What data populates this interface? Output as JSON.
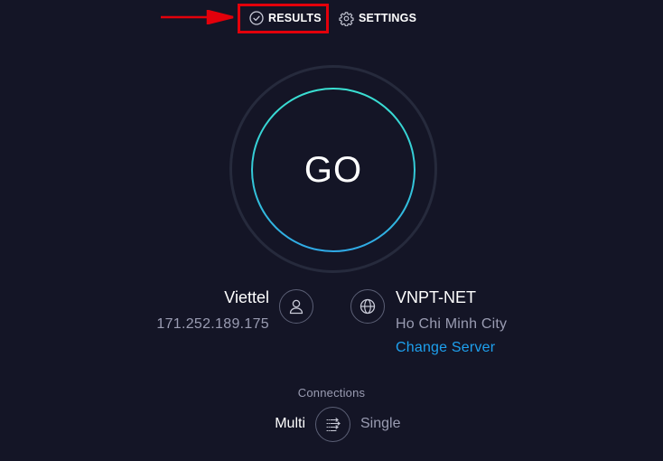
{
  "nav": {
    "results_label": "RESULTS",
    "settings_label": "SETTINGS",
    "results_icon": "check-circle-icon",
    "settings_icon": "gear-icon",
    "highlight_color": "#e3000b"
  },
  "go_button": {
    "label": "GO",
    "ring_colors": [
      "#3ae0d2",
      "#2fa9e6"
    ]
  },
  "provider": {
    "name": "Viettel",
    "ip": "171.252.189.175",
    "icon": "user-icon"
  },
  "server": {
    "name": "VNPT-NET",
    "location": "Ho Chi Minh City",
    "change_label": "Change Server",
    "icon": "globe-icon",
    "link_color": "#1ea0ee"
  },
  "connections": {
    "title": "Connections",
    "multi_label": "Multi",
    "single_label": "Single",
    "selected": "Multi",
    "icon": "connections-toggle-icon"
  },
  "colors": {
    "background": "#141526",
    "muted_text": "#9a9cb2"
  }
}
